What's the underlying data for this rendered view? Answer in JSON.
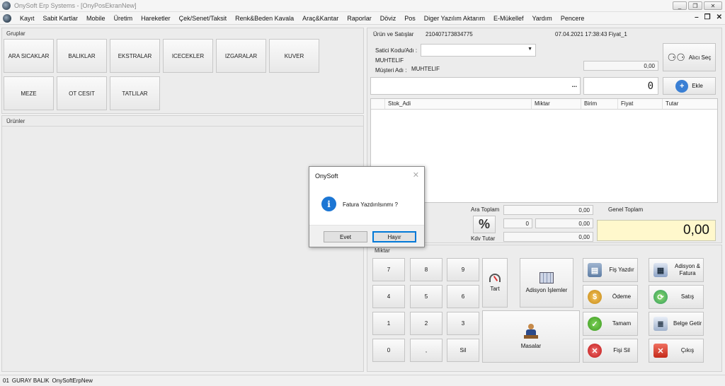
{
  "window": {
    "title": "OnySoft Erp Systems - [OnyPosEkranNew]",
    "controls": [
      "_",
      "❐",
      "✕"
    ]
  },
  "menu": {
    "items": [
      "Kayıt",
      "Sabit Kartlar",
      "Mobile",
      "Üretim",
      "Hareketler",
      "Çek/Senet/Taksit",
      "Renk&Beden Kavala",
      "Araç&Kantar",
      "Raporlar",
      "Döviz",
      "Pos",
      "Diger Yazılım Aktarım",
      "E-Mükellef",
      "Yardım",
      "Pencere"
    ],
    "mdi_controls": [
      "–",
      "❐",
      "✕"
    ]
  },
  "groups": {
    "caption": "Gruplar",
    "buttons": [
      "ARA SICAKLAR",
      "BALIKLAR",
      "EKSTRALAR",
      "ICECEKLER",
      "IZGARALAR",
      "KUVER",
      "MEZE",
      "OT CESIT",
      "TATLILAR"
    ]
  },
  "products": {
    "caption": "Ürünler"
  },
  "sale": {
    "caption": "Ürün ve Satışlar",
    "doc_no": "210407173834775",
    "datetime": "07.04.2021 17:38:43 Fiyat_1",
    "seller_label": "Satici Kodu/Adı :",
    "seller_name": "MUHTELIF",
    "customer_label": "Müşteri Adı :",
    "customer_name": "MUHTELIF",
    "balance": "0,00",
    "buyer_button": "Alıcı Seç",
    "barcode_button": "...",
    "quantity": "0",
    "add_button": "Ekle"
  },
  "grid": {
    "columns": [
      "Stok_Adi",
      "Miktar",
      "Birim",
      "Fiyat",
      "Tutar"
    ]
  },
  "totals": {
    "subtotal_label": "Ara Toplam",
    "subtotal": "0,00",
    "percent_symbol": "%",
    "discount_percent": "0",
    "discount_amount": "0,00",
    "vat_label": "Kdv Tutar",
    "vat": "0,00",
    "grand_total_label": "Genel Toplam",
    "grand_total": "0,00"
  },
  "keypad": {
    "caption": "Miktar",
    "keys": [
      "7",
      "8",
      "9",
      "4",
      "5",
      "6",
      "1",
      "2",
      "3",
      "0",
      ",",
      "Sil"
    ],
    "scale": "Tart",
    "table_ops": "Adisyon İşlemler",
    "tables": "Masalar"
  },
  "actions": {
    "print_receipt": "Fiş Yazdır",
    "payment": "Ödeme",
    "complete": "Tamam",
    "delete_receipt": "Fişi Sil",
    "bill_invoice": "Adisyon & Fatura",
    "sale": "Satış",
    "fetch_document": "Belge Getir",
    "exit": "Çıkış"
  },
  "status": {
    "code": "01",
    "user": "GURAY BALIK",
    "app": "OnySoftErpNew"
  },
  "dialog": {
    "title": "OnySoft",
    "close": "✕",
    "icon": "i",
    "message": "Fatura Yazdırılsınmı ?",
    "yes": "Evet",
    "no": "Hayır"
  }
}
